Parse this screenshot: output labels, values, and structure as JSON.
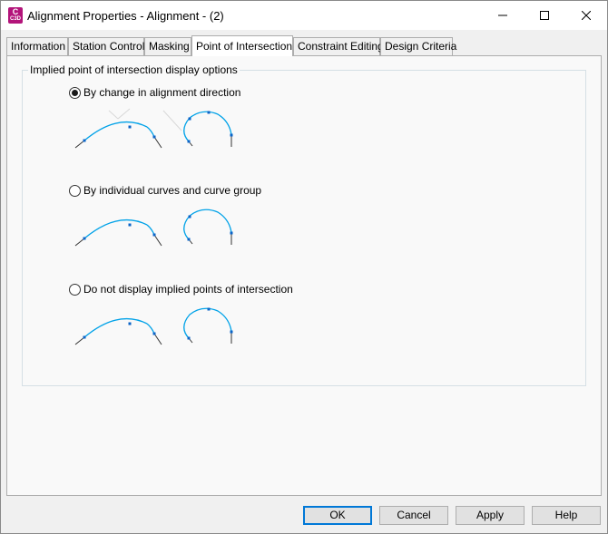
{
  "window": {
    "app_icon_letter": "C",
    "app_icon_sub": "C3D",
    "title": "Alignment Properties - Alignment - (2)",
    "controls": {
      "minimize": "minimize-icon",
      "maximize": "maximize-icon",
      "close": "close-icon"
    }
  },
  "tabs": [
    {
      "label": "Information",
      "active": false
    },
    {
      "label": "Station Control",
      "active": false
    },
    {
      "label": "Masking",
      "active": false
    },
    {
      "label": "Point of Intersection",
      "active": true
    },
    {
      "label": "Constraint Editing",
      "active": false
    },
    {
      "label": "Design Criteria",
      "active": false
    }
  ],
  "group": {
    "legend": "Implied point of intersection display options",
    "options": [
      {
        "label": "By change in alignment direction",
        "selected": true
      },
      {
        "label": "By individual curves and curve group",
        "selected": false
      },
      {
        "label": "Do not display implied points of intersection",
        "selected": false
      }
    ]
  },
  "buttons": {
    "ok": "OK",
    "cancel": "Cancel",
    "apply": "Apply",
    "help": "Help"
  },
  "colors": {
    "curve": "#00a2e8",
    "grip": "#0a64c8",
    "tangent": "#333333",
    "guide": "#d8d8d8",
    "default_button_border": "#0078d7",
    "app_icon": "#b3147a"
  }
}
